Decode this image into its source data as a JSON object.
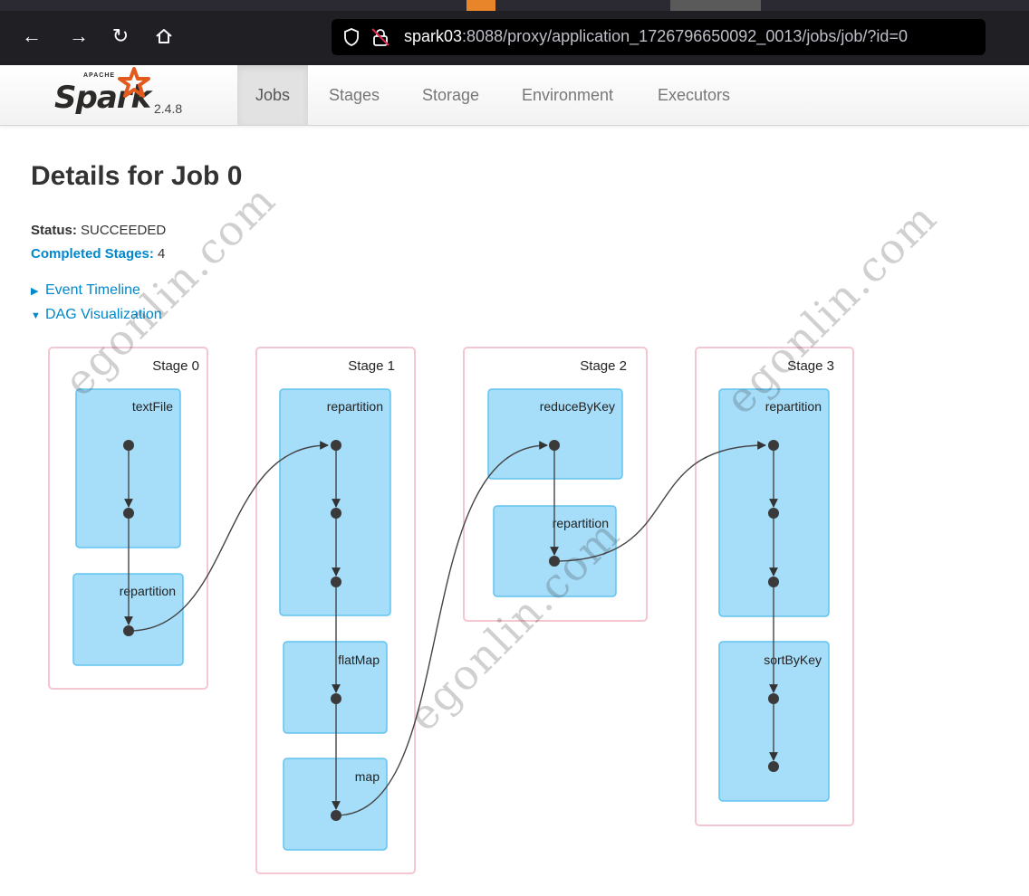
{
  "browser": {
    "url_host": "spark03",
    "url_rest": ":8088/proxy/application_1726796650092_0013/jobs/job/?id=0"
  },
  "navbar": {
    "brand_apache": "APACHE",
    "brand_name": "Spark",
    "version": "2.4.8",
    "tabs": [
      {
        "label": "Jobs",
        "active": true
      },
      {
        "label": "Stages",
        "active": false
      },
      {
        "label": "Storage",
        "active": false
      },
      {
        "label": "Environment",
        "active": false
      },
      {
        "label": "Executors",
        "active": false
      }
    ]
  },
  "page": {
    "title": "Details for Job 0",
    "status_label": "Status:",
    "status_value": "SUCCEEDED",
    "completed_label": "Completed Stages:",
    "completed_value": "4",
    "event_timeline": "Event Timeline",
    "dag_visualization": "DAG Visualization"
  },
  "dag": {
    "stages": [
      {
        "label": "Stage 0",
        "ops": [
          "textFile",
          "repartition"
        ]
      },
      {
        "label": "Stage 1",
        "ops": [
          "repartition",
          "flatMap",
          "map"
        ]
      },
      {
        "label": "Stage 2",
        "ops": [
          "reduceByKey",
          "repartition"
        ]
      },
      {
        "label": "Stage 3",
        "ops": [
          "repartition",
          "sortByKey"
        ]
      }
    ]
  },
  "watermark": "egonlin.com",
  "colors": {
    "stage_border": "#f4c6cf",
    "op_fill": "#a6ddf9",
    "op_border": "#60c3f1",
    "link": "#0088cc"
  }
}
